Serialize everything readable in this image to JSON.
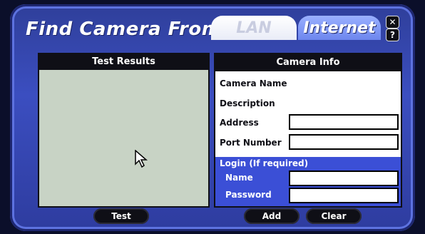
{
  "window": {
    "title": "Find Camera From",
    "tabs": [
      {
        "label": "LAN",
        "active": false
      },
      {
        "label": "Internet",
        "active": true
      }
    ],
    "close_icon": "close-icon",
    "help_icon": "help-icon"
  },
  "test_results": {
    "header": "Test Results"
  },
  "camera_info": {
    "header": "Camera Info",
    "camera_name_label": "Camera Name",
    "description_label": "Description",
    "address_label": "Address",
    "address_value": "",
    "port_label": "Port Number",
    "port_value": "",
    "login_title": "Login (If required)",
    "name_label": "Name",
    "name_value": "",
    "password_label": "Password",
    "password_value": ""
  },
  "buttons": {
    "test": "Test",
    "add": "Add",
    "clear": "Clear"
  },
  "colors": {
    "frame_blue": "#3b4ec0",
    "panel_dark": "#0f0f16",
    "results_bg": "#c8d3c5",
    "login_blue": "#3b4fd6"
  }
}
